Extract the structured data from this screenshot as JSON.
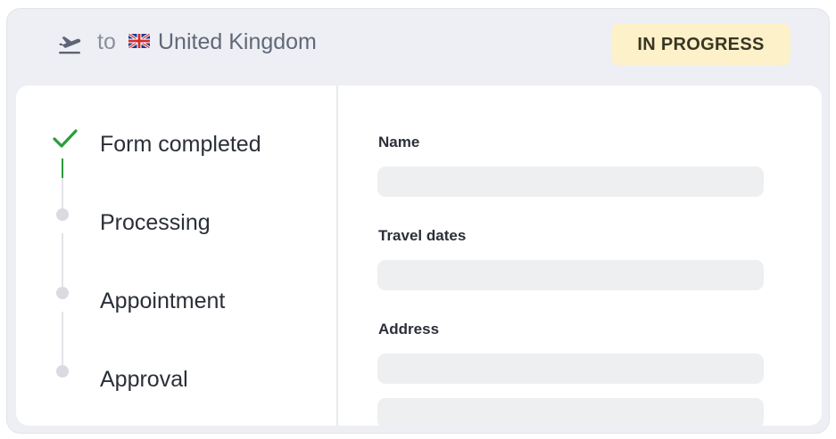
{
  "header": {
    "destination_prefix": "to",
    "country": "United Kingdom",
    "flag_icon": "uk-flag-icon",
    "departure_icon": "airplane-departure-icon",
    "status_badge": "IN PROGRESS",
    "badge_color": "#fcf1c9"
  },
  "steps": [
    {
      "label": "Form completed",
      "state": "completed",
      "icon": "check-icon"
    },
    {
      "label": "Processing",
      "state": "pending"
    },
    {
      "label": "Appointment",
      "state": "pending"
    },
    {
      "label": "Approval",
      "state": "pending"
    }
  ],
  "form": {
    "fields": [
      {
        "label": "Name",
        "value": ""
      },
      {
        "label": "Travel dates",
        "value": ""
      },
      {
        "label": "Address",
        "value": ""
      }
    ]
  },
  "colors": {
    "completed": "#2a9d3a",
    "pending_dot": "#d9dbe0"
  }
}
